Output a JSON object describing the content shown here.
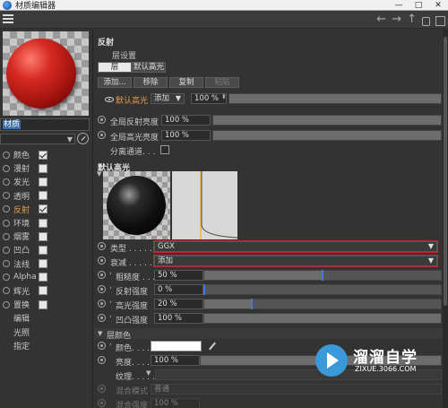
{
  "window": {
    "title": "材质编辑器",
    "minimize": "—",
    "maximize": "□",
    "close": "✕"
  },
  "toolbar": {
    "back": "←",
    "forward": "→",
    "up": "↑"
  },
  "material": {
    "name": "材质"
  },
  "channels": [
    {
      "label": "颜色",
      "checked": true,
      "active": false
    },
    {
      "label": "漫射",
      "checked": false,
      "active": false
    },
    {
      "label": "发光",
      "checked": false,
      "active": false
    },
    {
      "label": "透明",
      "checked": false,
      "active": false
    },
    {
      "label": "反射",
      "checked": true,
      "active": true
    },
    {
      "label": "环境",
      "checked": false,
      "active": false
    },
    {
      "label": "烟雾",
      "checked": false,
      "active": false
    },
    {
      "label": "凹凸",
      "checked": false,
      "active": false
    },
    {
      "label": "法线",
      "checked": false,
      "active": false
    },
    {
      "label": "Alpha",
      "checked": false,
      "active": false
    },
    {
      "label": "辉光",
      "checked": false,
      "active": false
    },
    {
      "label": "置换",
      "checked": false,
      "active": false
    }
  ],
  "extra_items": [
    "编辑",
    "光照",
    "指定"
  ],
  "reflect": {
    "title": "反射",
    "layer_settings": "层设置",
    "tab_layer": "层",
    "tab_default": "默认高光",
    "btn_add": "添加...",
    "btn_remove": "移除",
    "btn_copy": "复制",
    "btn_paste": "粘贴",
    "spec_layer_name": "默认高光",
    "spec_mode": "添加",
    "spec_percent": "100 %",
    "global_reflect_label": "全局反射亮度",
    "global_reflect_value": "100 %",
    "global_spec_label": "全局高光亮度",
    "global_spec_value": "100 %",
    "separate_label": "分离通道. . ."
  },
  "default_spec": {
    "title": "默认高光",
    "type_label": "类型 . . . . . .",
    "type_value": "GGX",
    "atten_label": "衰减 . . . . . .",
    "atten_value": "添加",
    "roughness_label": "粗糙度 . . .",
    "roughness_value": "50 %",
    "roughness_level": 0.5,
    "reflect_strength_label": "反射强度",
    "reflect_strength_value": "0 %",
    "reflect_strength_level": 0.0,
    "spec_strength_label": "高光强度",
    "spec_strength_value": "20 %",
    "spec_strength_level": 0.2,
    "bump_strength_label": "凹凸强度",
    "bump_strength_value": "100 %",
    "bump_strength_level": 1.0
  },
  "layer_color": {
    "title": "层颜色",
    "color_label": "颜色. . . . .",
    "color_hex": "#ffffff",
    "brightness_label": "亮度. . . . .",
    "brightness_value": "100 %",
    "texture_label": "纹理. . . . .",
    "blend_mode_label": "混合模式",
    "blend_mode_value": "普通",
    "blend_strength_label": "混合强度",
    "blend_strength_value": "100 %"
  },
  "watermark": {
    "text": "溜溜自学",
    "sub": "ZIXUE.3066.COM"
  },
  "colors": {
    "accent_active": "#e79b4b",
    "highlight_border": "#c0272d",
    "knob": "#3d7bd9"
  }
}
